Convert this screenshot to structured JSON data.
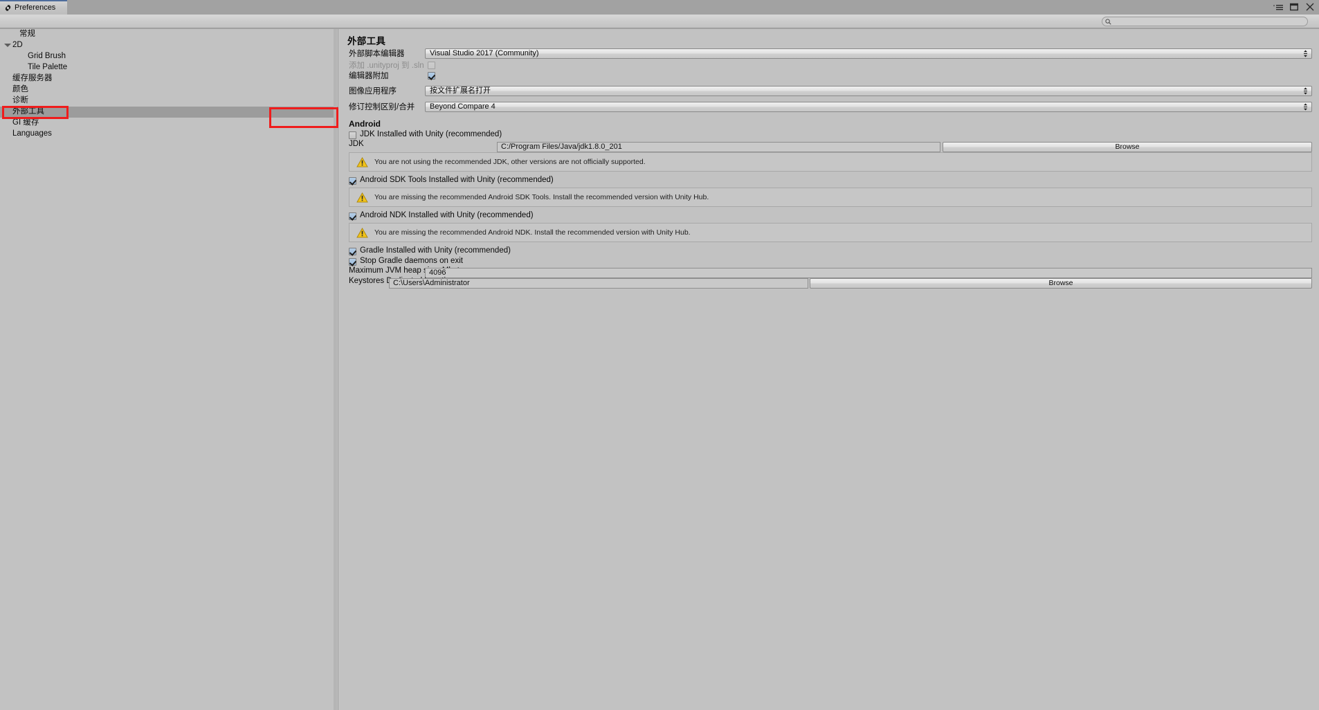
{
  "window": {
    "tab_label": "Preferences",
    "tab_icon": "gear-icon",
    "controls": {
      "menu": "dropdown-menu-icon",
      "maximize": "maximize-icon",
      "close": "close-icon"
    }
  },
  "search": {
    "value": "",
    "placeholder": "",
    "icon": "search-icon"
  },
  "sidebar": {
    "items": [
      {
        "label": "常规",
        "indent": 0,
        "selected": false,
        "foldout": false
      },
      {
        "label": "2D",
        "indent": 0,
        "selected": false,
        "foldout": true
      },
      {
        "label": "Grid Brush",
        "indent": 1,
        "selected": false,
        "foldout": false
      },
      {
        "label": "Tile Palette",
        "indent": 1,
        "selected": false,
        "foldout": false
      },
      {
        "label": "缓存服务器",
        "indent": 0,
        "selected": false,
        "foldout": false
      },
      {
        "label": "颜色",
        "indent": 0,
        "selected": false,
        "foldout": false
      },
      {
        "label": "诊断",
        "indent": 0,
        "selected": false,
        "foldout": false
      },
      {
        "label": "外部工具",
        "indent": 0,
        "selected": true,
        "foldout": false
      },
      {
        "label": "GI 缓存",
        "indent": 0,
        "selected": false,
        "foldout": false
      },
      {
        "label": "Languages",
        "indent": 0,
        "selected": false,
        "foldout": false
      }
    ]
  },
  "content": {
    "title": "外部工具",
    "external_script_editor": {
      "label": "外部脚本编辑器",
      "value": "Visual Studio 2017 (Community)"
    },
    "add_unityproj": {
      "label": "添加 .unityproj 到 .sln",
      "checked": false,
      "disabled": true
    },
    "editor_attaching": {
      "label": "编辑器附加",
      "checked": true
    },
    "image_application": {
      "label": "图像应用程序",
      "value": "按文件扩展名打开"
    },
    "revision_control": {
      "label": "修订控制区别/合并",
      "value": "Beyond Compare 4"
    },
    "android": {
      "section_title": "Android",
      "jdk_installed": {
        "label": "JDK Installed with Unity (recommended)",
        "checked": false
      },
      "jdk_path": {
        "label": "JDK",
        "value": "C:/Program Files/Java/jdk1.8.0_201",
        "browse_label": "Browse"
      },
      "jdk_warning": "You are not using the recommended JDK, other versions are not officially supported.",
      "sdk_installed": {
        "label": "Android SDK Tools Installed with Unity (recommended)",
        "checked": true
      },
      "sdk_warning": "You are missing the recommended Android SDK Tools. Install the recommended version with Unity Hub.",
      "ndk_installed": {
        "label": "Android NDK Installed with Unity (recommended)",
        "checked": true
      },
      "ndk_warning": "You are missing the recommended Android NDK. Install the recommended version with Unity Hub.",
      "gradle_installed": {
        "label": "Gradle Installed with Unity (recommended)",
        "checked": true
      },
      "stop_gradle_daemons": {
        "label": "Stop Gradle daemons on exit",
        "checked": true
      },
      "max_jvm_heap": {
        "label": "Maximum JVM heap size, Mbytes",
        "value": "4096"
      },
      "keystores_location": {
        "label": "Keystores Dedicated Location",
        "value": "C:\\Users\\Administrator",
        "browse_label": "Browse"
      }
    }
  },
  "annotations": {
    "highlight_color": "#ef1c1c",
    "boxes": [
      {
        "name": "sidebar-external-tools-highlight"
      },
      {
        "name": "android-section-highlight"
      }
    ]
  }
}
